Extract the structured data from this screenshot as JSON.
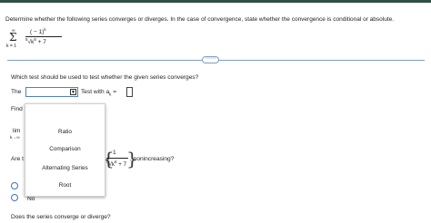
{
  "question": {
    "prompt": "Determine whether the following series converges or diverges. In the case of convergence, state whether the convergence is conditional or absolute.",
    "series": {
      "sigma": "Σ",
      "upper_limit": "∞",
      "lower_limit": "k = 1",
      "numerator_base": "( − 1)",
      "numerator_exp": "k",
      "denominator_index": "5",
      "denominator_radical": "√",
      "denominator_base": "k",
      "denominator_exp": "6",
      "denominator_tail": " + 7"
    },
    "more_button": "⋯⋯"
  },
  "test_question": {
    "prompt": "Which test should be used to test whether the given series converges?",
    "the_label": "The",
    "select_arrow": "▼",
    "test_with_label": "Test with a",
    "test_with_sub": "k",
    "test_with_eq": " = "
  },
  "partial_lines": {
    "find": "Find",
    "lim": "lim",
    "lim_sub": "k→∞",
    "are": "Are t"
  },
  "dropdown": {
    "options": [
      "Ratio",
      "Comparison",
      "Alternating Series",
      "Root"
    ]
  },
  "term_fraction": {
    "numerator": "1",
    "denominator_index": "5",
    "denominator_radical": "√",
    "denominator_base": "k",
    "denominator_exp": "6",
    "denominator_tail": " + 7",
    "brace_open": "{",
    "brace_close": "}",
    "suffix": ", nonincreasing?"
  },
  "answer_options": {
    "no_label": "No"
  },
  "final_question": "Does the series converge or diverge?",
  "colors": {
    "topbar": "#2e4f46",
    "accent_blue": "#3d73c6",
    "divider": "#7f9cc6"
  }
}
